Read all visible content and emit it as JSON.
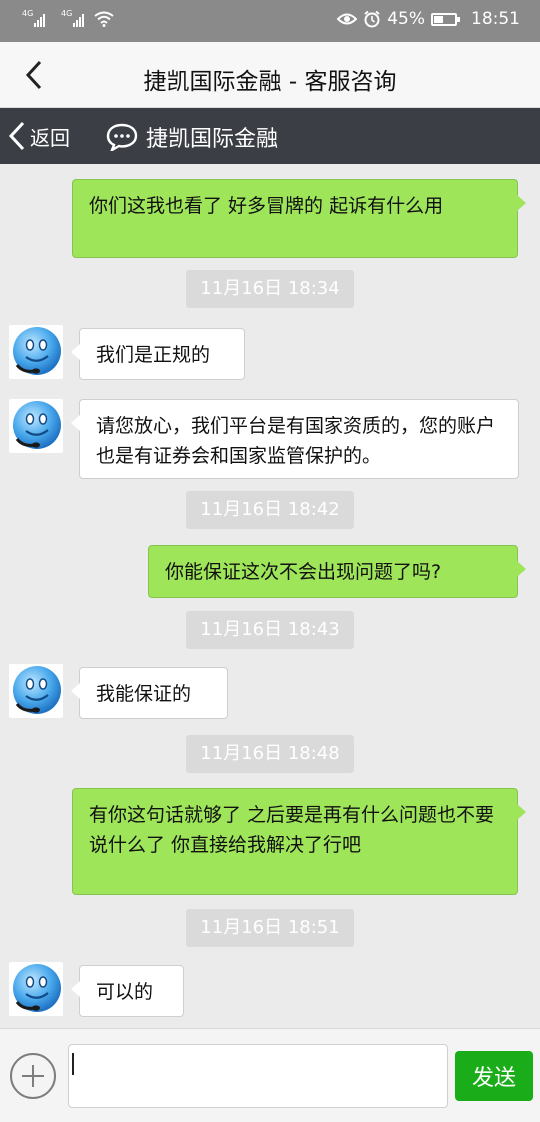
{
  "status_bar": {
    "sim1": "4G",
    "sim2": "4G",
    "battery": "45%",
    "time": "18:51"
  },
  "header": {
    "title": "捷凯国际金融 - 客服咨询"
  },
  "subheader": {
    "back_label": "返回",
    "brand": "捷凯国际金融"
  },
  "messages": [
    {
      "from": "me",
      "text": "你们这我也看了 好多冒牌的 起诉有什么用"
    },
    {
      "type": "time",
      "text": "11月16日 18:34"
    },
    {
      "from": "agent",
      "text": "我们是正规的"
    },
    {
      "from": "agent",
      "text": "请您放心，我们平台是有国家资质的，您的账户也是有证券会和国家监管保护的。"
    },
    {
      "type": "time",
      "text": "11月16日 18:42"
    },
    {
      "from": "me",
      "text": "你能保证这次不会出现问题了吗?"
    },
    {
      "type": "time",
      "text": "11月16日 18:43"
    },
    {
      "from": "agent",
      "text": "我能保证的"
    },
    {
      "type": "time",
      "text": "11月16日 18:48"
    },
    {
      "from": "me",
      "text": "有你这句话就够了 之后要是再有什么问题也不要说什么了 你直接给我解决了行吧"
    },
    {
      "type": "time",
      "text": "11月16日 18:51"
    },
    {
      "from": "agent",
      "text": "可以的"
    }
  ],
  "composer": {
    "value": "",
    "send_label": "发送"
  },
  "colors": {
    "my_bubble": "#9ee55a",
    "agent_bubble": "#ffffff",
    "send_button": "#1aad19",
    "subheader": "#3b3f45"
  }
}
